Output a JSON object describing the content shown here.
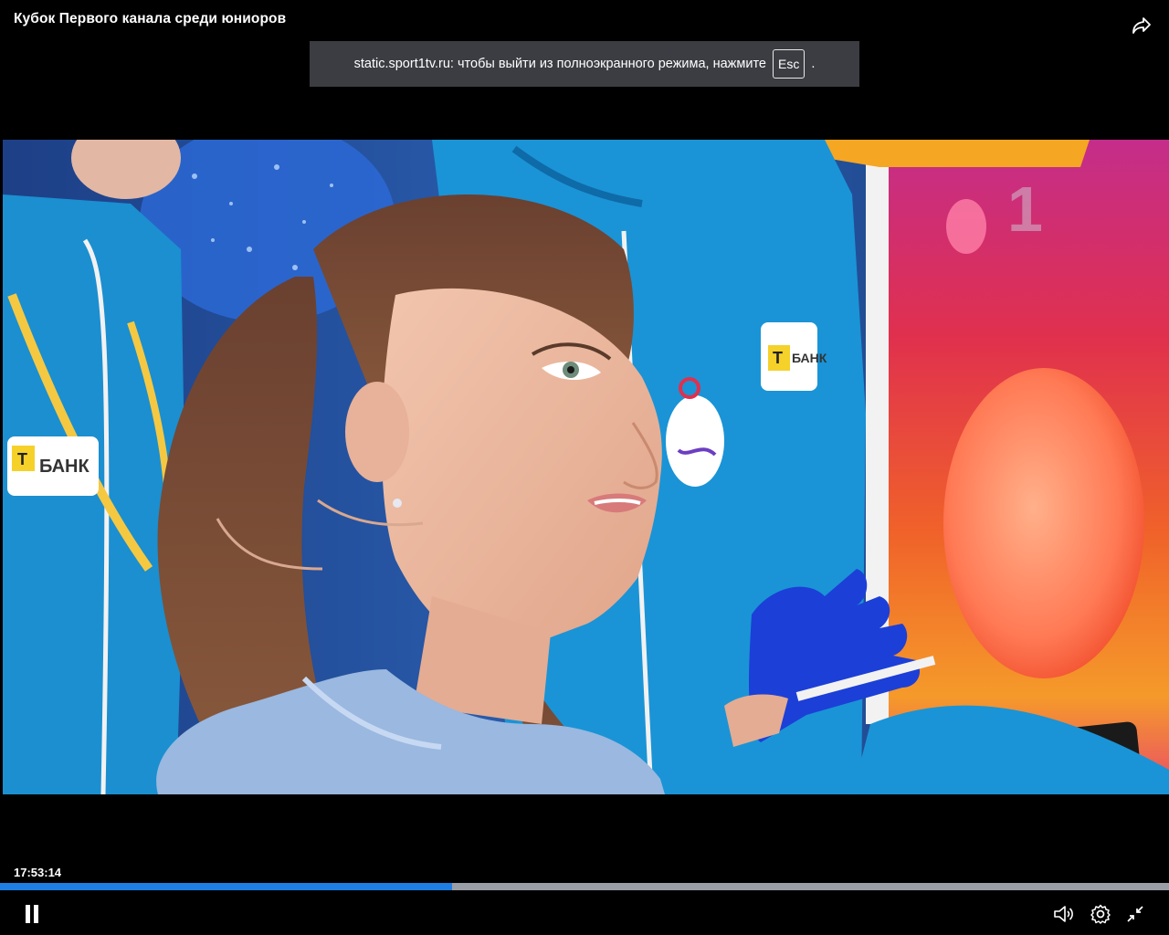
{
  "header": {
    "title": "Кубок Первого канала среди юниоров",
    "share_icon": "share-icon"
  },
  "fullscreen_notice": {
    "text_before": "static.sport1tv.ru: чтобы выйти из полноэкранного режима, нажмите",
    "key": "Esc",
    "text_after": "."
  },
  "video": {
    "sponsor_left": "БАНК",
    "sponsor_right": "БАНК",
    "sponsor_letter": "Т"
  },
  "player": {
    "timecode": "17:53:14",
    "progress_fraction": 0.387,
    "colors": {
      "progress_fill": "#1f7ee3",
      "progress_track": "#9a9ea6"
    },
    "controls": [
      "pause-icon",
      "volume-icon",
      "settings-icon",
      "exit-fullscreen-icon"
    ]
  }
}
